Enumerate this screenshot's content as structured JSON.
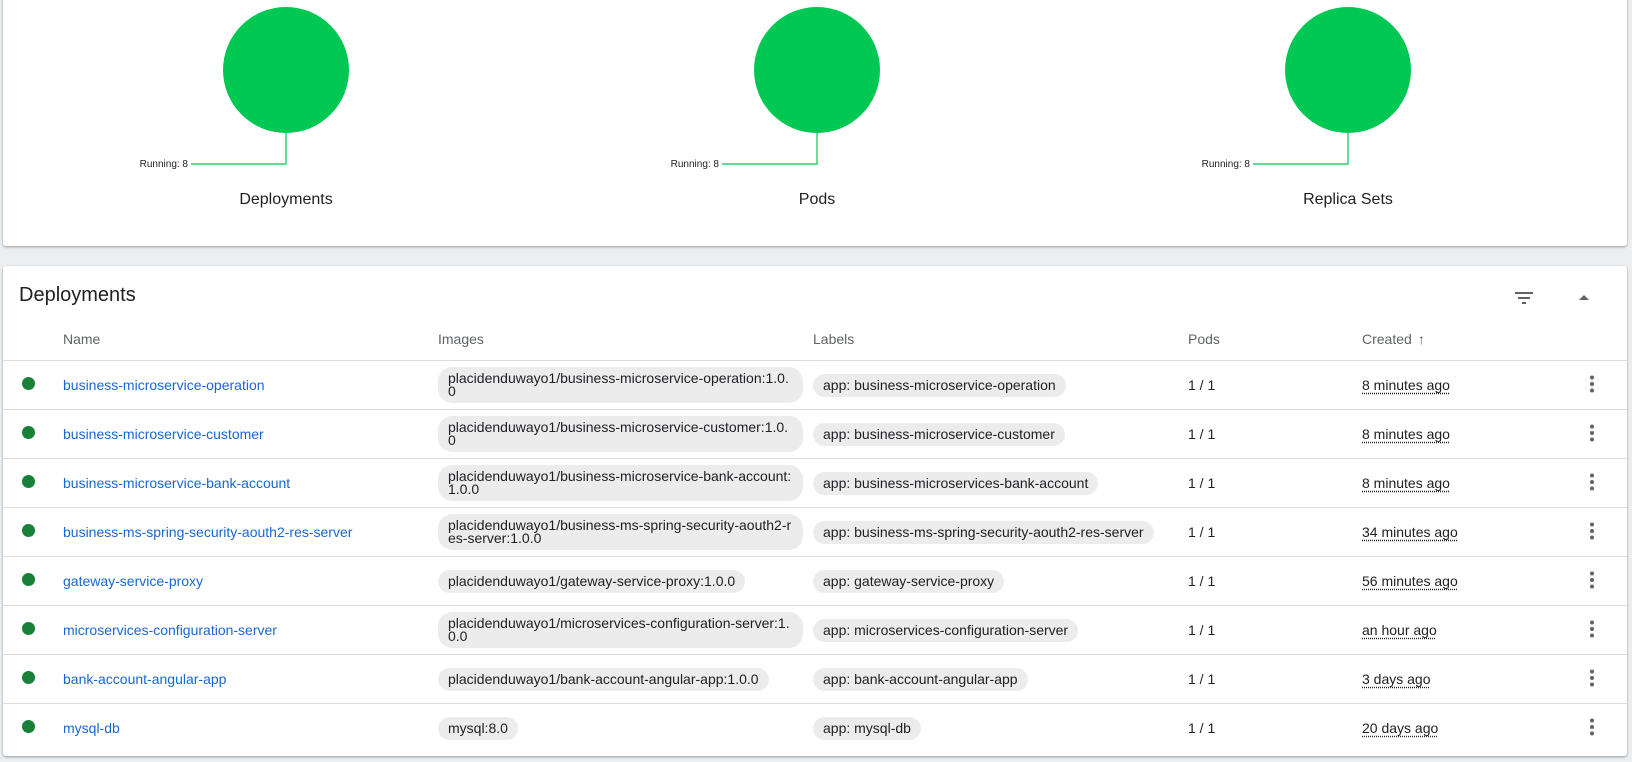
{
  "summary": {
    "charts": [
      {
        "title": "Deployments",
        "label": "Running: 8",
        "color": "#00c853"
      },
      {
        "title": "Pods",
        "label": "Running: 8",
        "color": "#00c853"
      },
      {
        "title": "Replica Sets",
        "label": "Running: 8",
        "color": "#00c853"
      }
    ]
  },
  "deployments": {
    "title": "Deployments",
    "filter_icon": "filter-list-icon",
    "collapse_icon": "arrow-drop-up-icon",
    "columns": {
      "name": "Name",
      "images": "Images",
      "labels": "Labels",
      "pods": "Pods",
      "created": "Created"
    },
    "sort_icon": "arrow-upward-icon",
    "rows": [
      {
        "name": "business-microservice-operation",
        "image": "placidenduwayo1/business-microservice-operation:1.0.0",
        "label": "app: business-microservice-operation",
        "pods": "1 / 1",
        "created": "8 minutes ago"
      },
      {
        "name": "business-microservice-customer",
        "image": "placidenduwayo1/business-microservice-customer:1.0.0",
        "label": "app: business-microservice-customer",
        "pods": "1 / 1",
        "created": "8 minutes ago"
      },
      {
        "name": "business-microservice-bank-account",
        "image": "placidenduwayo1/business-microservice-bank-account:1.0.0",
        "label": "app: business-microservices-bank-account",
        "pods": "1 / 1",
        "created": "8 minutes ago"
      },
      {
        "name": "business-ms-spring-security-aouth2-res-server",
        "image": "placidenduwayo1/business-ms-spring-security-aouth2-res-server:1.0.0",
        "label": "app: business-ms-spring-security-aouth2-res-server",
        "pods": "1 / 1",
        "created": "34 minutes ago"
      },
      {
        "name": "gateway-service-proxy",
        "image": "placidenduwayo1/gateway-service-proxy:1.0.0",
        "label": "app: gateway-service-proxy",
        "pods": "1 / 1",
        "created": "56 minutes ago"
      },
      {
        "name": "microservices-configuration-server",
        "image": "placidenduwayo1/microservices-configuration-server:1.0.0",
        "label": "app: microservices-configuration-server",
        "pods": "1 / 1",
        "created": "an hour ago"
      },
      {
        "name": "bank-account-angular-app",
        "image": "placidenduwayo1/bank-account-angular-app:1.0.0",
        "label": "app: bank-account-angular-app",
        "pods": "1 / 1",
        "created": "3 days ago"
      },
      {
        "name": "mysql-db",
        "image": "mysql:8.0",
        "label": "app: mysql-db",
        "pods": "1 / 1",
        "created": "20 days ago"
      }
    ],
    "status_color": "#188038",
    "row_action_icon": "more-vert-icon"
  }
}
